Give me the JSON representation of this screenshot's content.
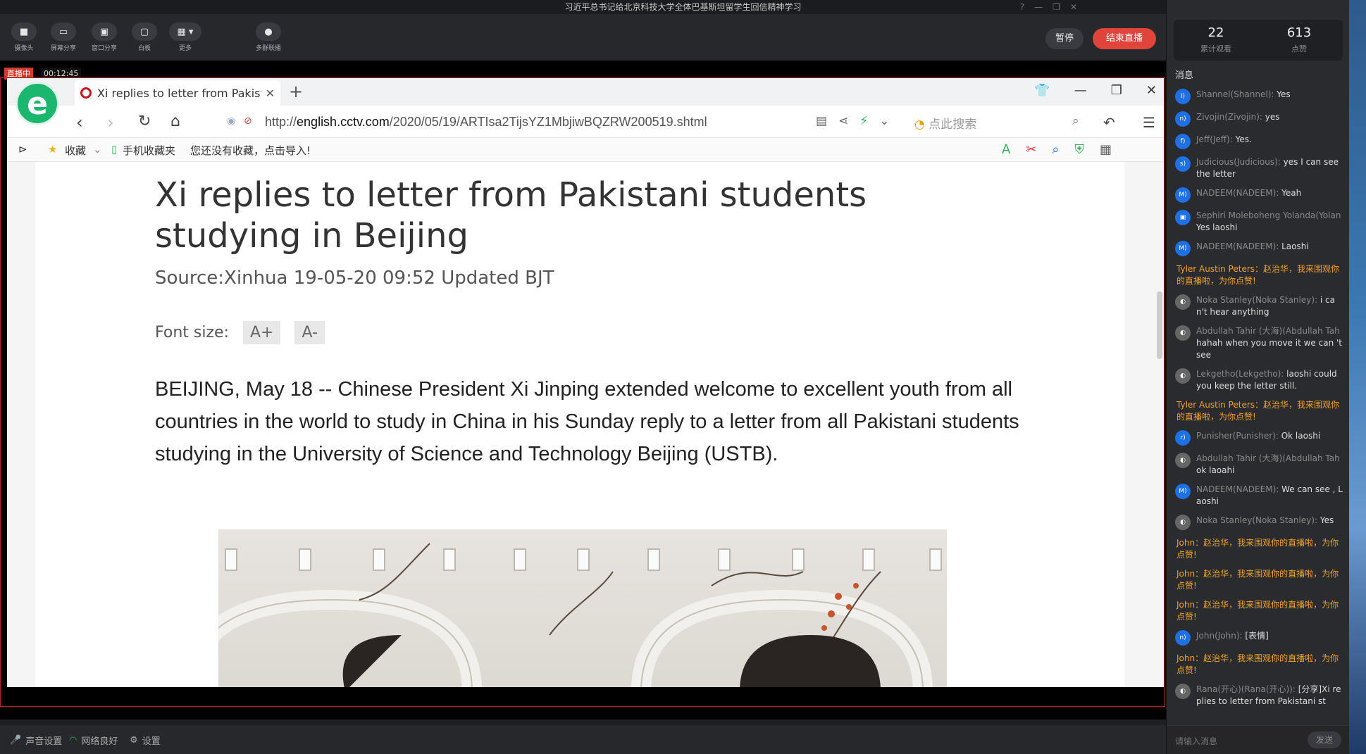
{
  "app": {
    "window_title": "习近平总书记给北京科技大学全体巴基斯坦留学生回信精神学习"
  },
  "toolbar": {
    "buttons": [
      {
        "label": "摄像头",
        "icon": "camera-icon"
      },
      {
        "label": "屏幕分享",
        "icon": "screen-share-icon"
      },
      {
        "label": "窗口分享",
        "icon": "window-share-icon"
      },
      {
        "label": "白板",
        "icon": "whiteboard-icon"
      },
      {
        "label": "更多",
        "icon": "grid-icon"
      },
      {
        "label": "多群联播",
        "icon": "multi-group-icon"
      }
    ],
    "pause_label": "暂停",
    "end_live_label": "结束直播"
  },
  "live": {
    "badge": "直播中",
    "elapsed": "00:12:45"
  },
  "stats": {
    "viewers_value": "22",
    "viewers_label": "累计观看",
    "likes_value": "613",
    "likes_label": "点赞"
  },
  "messages_title": "消息",
  "messages": [
    {
      "type": "user",
      "avatar": "I)",
      "name": "Shannel(Shannel):",
      "text": " Yes"
    },
    {
      "type": "user",
      "avatar": "n)",
      "name": "Zivojin(Zivojin):",
      "text": " yes"
    },
    {
      "type": "user",
      "avatar": "f)",
      "name": "Jeff(Jeff):",
      "text": " Yes."
    },
    {
      "type": "user",
      "avatar": "s)",
      "name": "Judicious(Judicious):",
      "text": " yes I can see the letter"
    },
    {
      "type": "user",
      "avatar": "M)",
      "name": "NADEEM(NADEEM):",
      "text": " Yeah"
    },
    {
      "type": "user",
      "avatar": "▣",
      "name": "Sephiri Moleboheng Yolanda(Yolan",
      "text": "Yes laoshi"
    },
    {
      "type": "user",
      "avatar": "M)",
      "name": "NADEEM(NADEEM):",
      "text": " Laoshi"
    },
    {
      "type": "system",
      "text": "Tyler Austin Peters：赵治华，我来围观你的直播啦，为你点赞!"
    },
    {
      "type": "user",
      "avatar": "◐",
      "gray": true,
      "name": "Noka Stanley(Noka Stanley):",
      "text": " i can't hear anything"
    },
    {
      "type": "user",
      "avatar": "◐",
      "gray": true,
      "name": "Abdullah Tahir (大海)(Abdullah Tah",
      "text": "hahah when you move it we can 't see"
    },
    {
      "type": "user",
      "avatar": "◐",
      "gray": true,
      "name": "Lekgetho(Lekgetho):",
      "text": " laoshi could you keep the letter still."
    },
    {
      "type": "system",
      "text": "Tyler Austin Peters：赵治华，我来围观你的直播啦，为你点赞!"
    },
    {
      "type": "user",
      "avatar": "r)",
      "name": "Punisher(Punisher):",
      "text": " Ok laoshi"
    },
    {
      "type": "user",
      "avatar": "◐",
      "gray": true,
      "name": "Abdullah Tahir (大海)(Abdullah Tah",
      "text": "ok laoahi"
    },
    {
      "type": "user",
      "avatar": "M)",
      "name": "NADEEM(NADEEM):",
      "text": " We can see , Laoshi"
    },
    {
      "type": "user",
      "avatar": "◐",
      "gray": true,
      "name": "Noka Stanley(Noka Stanley):",
      "text": " Yes"
    },
    {
      "type": "system",
      "text": "John：赵治华，我来围观你的直播啦，为你点赞!"
    },
    {
      "type": "system",
      "text": "John：赵治华，我来围观你的直播啦，为你点赞!"
    },
    {
      "type": "system",
      "text": "John：赵治华，我来围观你的直播啦，为你点赞!"
    },
    {
      "type": "user",
      "avatar": "n)",
      "name": "John(John):",
      "text": " [表情]"
    },
    {
      "type": "system",
      "text": "John：赵治华，我来围观你的直播啦，为你点赞!"
    },
    {
      "type": "user",
      "avatar": "◐",
      "gray": true,
      "name": "Rana(开心)(Rana(开心)):",
      "text": " [分享]Xi replies to letter from Pakistani st"
    }
  ],
  "input": {
    "placeholder": "请输入消息",
    "send_label": "发送"
  },
  "statusbar": {
    "audio_label": "声音设置",
    "network_label": "网络良好",
    "settings_label": "设置"
  },
  "browser": {
    "tab_title": "Xi replies to letter from Pakist",
    "url_prefix": "http://",
    "url_host": "english.cctv.com",
    "url_path": "/2020/05/19/ARTIsa2TijsYZ1MbjiwBQZRW200519.shtml",
    "search_placeholder": "点此搜索",
    "favorites_label": "收藏",
    "mobile_fav_label": "手机收藏夹",
    "no_fav_hint": "您还没有收藏，点击导入!"
  },
  "article": {
    "title": "Xi replies to letter from Pakistani students studying in Beijing",
    "source": "Source:Xinhua 19-05-20 09:52 Updated BJT",
    "font_size_label": "Font size:",
    "font_plus": "A+",
    "font_minus": "A-",
    "body": "BEIJING, May 18 -- Chinese President Xi Jinping extended welcome to excellent youth from all countries in the world to study in China in his Sunday reply to a letter from all Pakistani students studying in the University of Science and Technology Beijing (USTB)."
  }
}
